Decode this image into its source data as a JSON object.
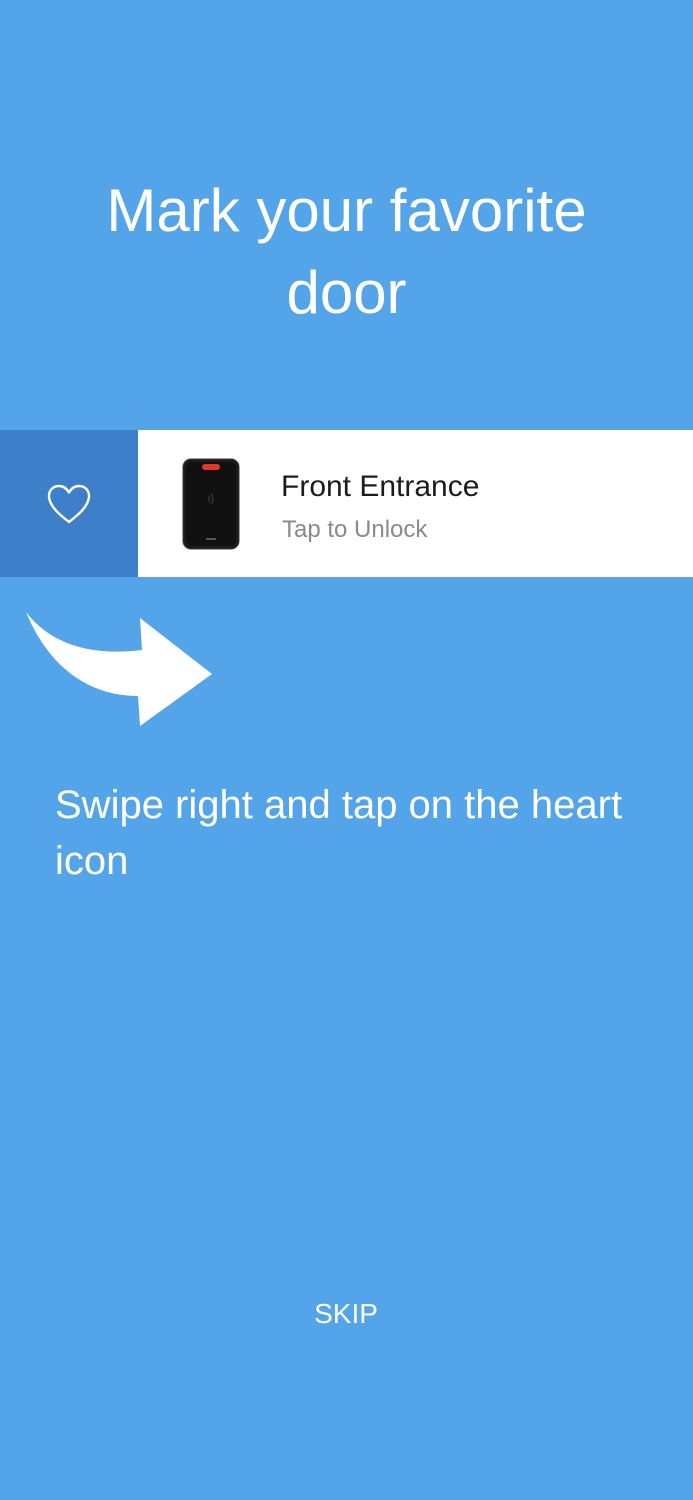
{
  "onboarding": {
    "title": "Mark your favorite door",
    "instruction": "Swipe right and tap on the heart icon",
    "skip_label": "SKIP"
  },
  "door": {
    "name": "Front Entrance",
    "subtitle": "Tap to Unlock",
    "icon": "card-reader-image"
  },
  "actions": {
    "favorite_icon": "heart-icon",
    "swipe_icon": "curved-arrow-right-icon"
  },
  "colors": {
    "background": "#53a4e8",
    "favorite_action_bg": "#3d7fc8",
    "row_bg": "#ffffff",
    "primary_text": "#1c1c1e",
    "secondary_text": "#8a8a8e",
    "reader_led": "#e5342a"
  }
}
